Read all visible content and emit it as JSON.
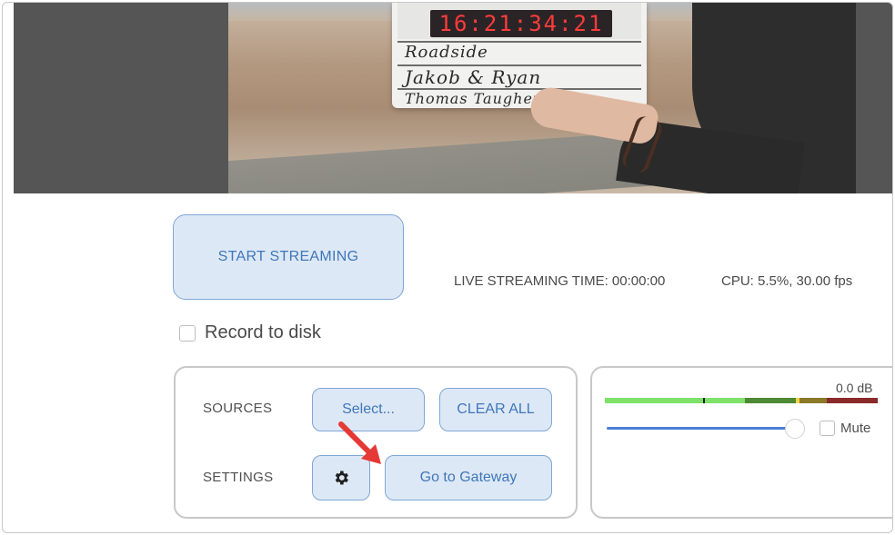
{
  "preview": {
    "slate_timecode": "16:21:34:21",
    "slate_lines": [
      "Roadside",
      "Jakob & Ryan",
      "Thomas Taugher"
    ]
  },
  "controls": {
    "start_label": "START STREAMING",
    "live_time": "LIVE STREAMING TIME: 00:00:00",
    "cpu": "CPU: 5.5%, 30.00 fps",
    "record_label": "Record to disk",
    "record_checked": false
  },
  "sources": {
    "label": "SOURCES",
    "select_label": "Select...",
    "clear_label": "CLEAR ALL"
  },
  "settings": {
    "label": "SETTINGS",
    "gear_icon": "gear-icon",
    "gateway_label": "Go to Gateway"
  },
  "audio": {
    "db_label": "0.0 dB",
    "volume": 1.0,
    "mute_label": "Mute",
    "mute_checked": false
  },
  "colors": {
    "accent": "#3f77b8",
    "button_bg": "#dde8f6",
    "button_border": "#7fa6d6",
    "annotation_arrow": "#e53935"
  }
}
